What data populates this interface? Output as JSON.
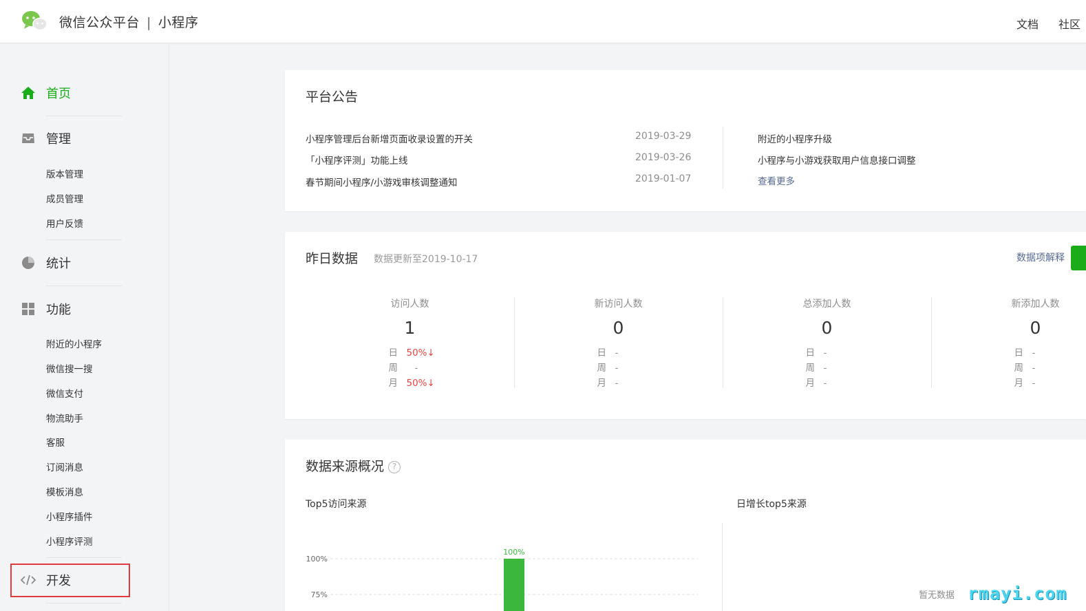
{
  "header": {
    "brand_name": "微信公众平台",
    "separator": "|",
    "product": "小程序",
    "links": [
      "文档",
      "社区"
    ]
  },
  "sidebar": {
    "home": "首页",
    "manage": {
      "label": "管理",
      "items": [
        "版本管理",
        "成员管理",
        "用户反馈"
      ]
    },
    "stats": "统计",
    "features": {
      "label": "功能",
      "items": [
        "附近的小程序",
        "微信搜一搜",
        "微信支付",
        "物流助手",
        "客服",
        "订阅消息",
        "模板消息",
        "小程序插件",
        "小程序评测"
      ]
    },
    "develop": "开发"
  },
  "announcements": {
    "title": "平台公告",
    "items": [
      {
        "text": "小程序管理后台新增页面收录设置的开关",
        "date": "2019-03-29"
      },
      {
        "text": "「小程序评测」功能上线",
        "date": "2019-03-26"
      },
      {
        "text": "春节期间小程序/小游戏审核调整通知",
        "date": "2019-01-07"
      }
    ],
    "right_items": [
      "附近的小程序升级",
      "小程序与小游戏获取用户信息接口调整"
    ],
    "more": "查看更多"
  },
  "yesterday": {
    "title": "昨日数据",
    "updated": "数据更新至2019-10-17",
    "explain_link": "数据项解释",
    "row_labels": [
      "日",
      "周",
      "月"
    ],
    "metrics": [
      {
        "label": "访问人数",
        "value": "1",
        "day": "50%↓",
        "week": "-",
        "month": "50%↓"
      },
      {
        "label": "新访问人数",
        "value": "0",
        "day": "-",
        "week": "-",
        "month": "-"
      },
      {
        "label": "总添加人数",
        "value": "0",
        "day": "-",
        "week": "-",
        "month": "-"
      },
      {
        "label": "新添加人数",
        "value": "0",
        "day": "-",
        "week": "-",
        "month": "-"
      }
    ]
  },
  "source": {
    "title": "数据来源概况",
    "help_glyph": "?",
    "left_title": "Top5访问来源",
    "right_title": "日增长top5来源",
    "no_data": "暂无数据"
  },
  "chart_data": {
    "type": "bar",
    "title": "Top5访问来源",
    "categories": [
      ""
    ],
    "values": [
      100
    ],
    "value_labels": [
      "100%"
    ],
    "yticks": [
      "100%",
      "75%"
    ],
    "ylim": [
      0,
      100
    ],
    "bar_color": "#3bb83b",
    "grid": true
  },
  "watermark": "rmayi.com",
  "colors": {
    "accent_green": "#1aad19",
    "link_blue": "#576b95",
    "down_red": "#e64340",
    "highlight_red": "#e0393e"
  }
}
